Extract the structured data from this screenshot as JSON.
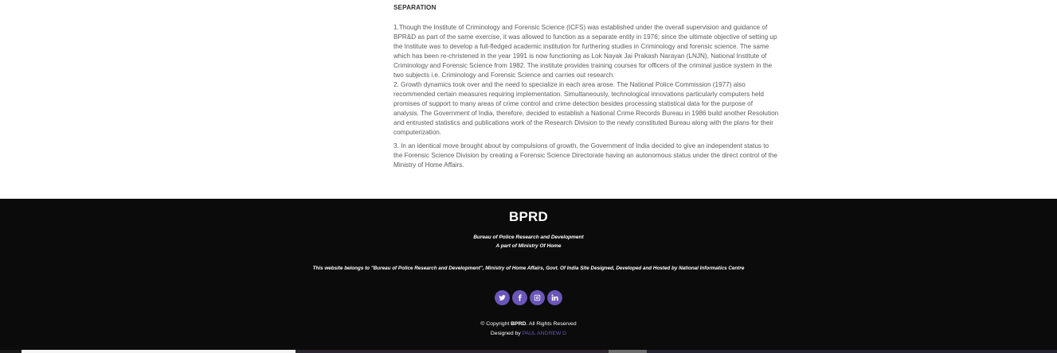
{
  "content": {
    "section_title": "SEPARATION",
    "paragraphs": [
      "1.Though the Institute of Criminology and Forensic Science (ICFS) was established under the overall supervision and guidance of BPR&D as part of the same exercise, it was allowed to function as a separate entity in 1976; since the ultimate objective of setting up the Institute was to develop a full-fledged academic institution for furthering studies in Criminology and forensic science. The same which has been re-christened in the year 1991 is now functioning as Lok Nayak Jai Prakash Narayan (LNJN), National Institute of Criminology and Forensic Science from 1982. The institute provides training courses for officers of the criminal justice system in the two subjects i.e. Criminology and Forensic Science and carries out research.",
      "2. Growth dynamics took over and the need to specialize in each area arose. The National Police Commission (1977) also recommended certain measures requiring implementation. Simultaneously, technological innovations particularly computers held promises of support to many areas of crime control and crime detection besides processing statistical data for the purpose of analysis. The Government of India, therefore, decided to establish a National Crime Records Bureau in 1986 build another Resolution and entrusted statistics and publications work of the Research Division to the newly constituted Bureau along with the plans for their computerization.",
      "3. In an identical move brought about by compulsions of growth, the Government of India decided to give an independent status to the Forensic Science Division by creating a Forensic Science Directorate having an autonomous status under the direct control of the Ministry of Home Affairs."
    ]
  },
  "footer": {
    "brand": "BPRD",
    "tagline_1": "Bureau of Police Research and Development",
    "tagline_2": "A part of Ministry Of Home",
    "ownership": "This website belongs to \"Bureau of Police Research and Development\", Ministry of Home Affairs, Govt. Of India Site Designed, Developed and Hosted by National Informatics Centre",
    "socials": [
      {
        "name": "twitter",
        "icon": "twitter-icon"
      },
      {
        "name": "facebook",
        "icon": "facebook-icon"
      },
      {
        "name": "instagram",
        "icon": "instagram-icon"
      },
      {
        "name": "linkedin",
        "icon": "linkedin-icon"
      }
    ],
    "copyright_prefix": "© Copyright",
    "copyright_brand": "BPRD",
    "copyright_suffix": ". All Rights Reserved",
    "designed_by_label": "Designed by",
    "designer": "PAUL ANDREW D"
  },
  "colors": {
    "footer_bg": "#0b0b0b",
    "accent": "#6a55b8",
    "body_text": "#5b5b5b"
  }
}
